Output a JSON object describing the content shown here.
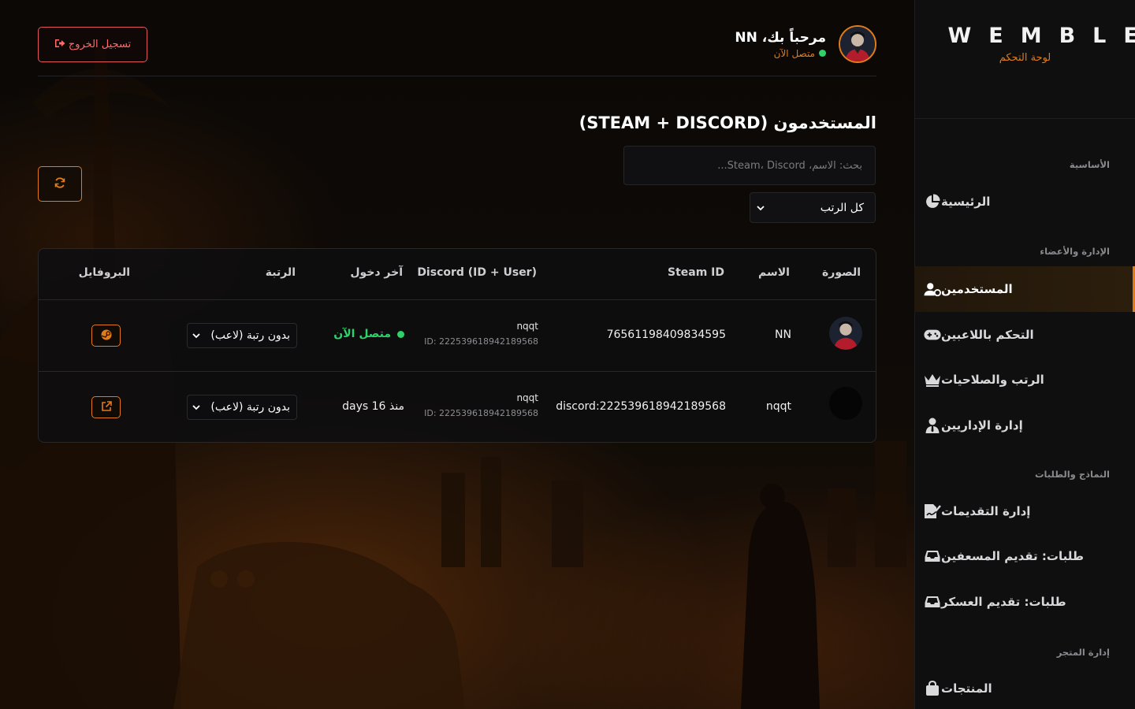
{
  "brand": {
    "name": "WEMBLEY",
    "subtitle": "لوحة التحكم"
  },
  "sidebar": {
    "sections": [
      {
        "title": "الأساسية"
      },
      {
        "title": "الإدارة والأعضاء"
      },
      {
        "title": "النماذج والطلبات"
      },
      {
        "title": "إدارة المتجر"
      }
    ],
    "items": [
      {
        "label": "الرئيسية",
        "icon": "pie-chart-icon"
      },
      {
        "label": "المستخدمين",
        "icon": "user-gear-icon",
        "active": true
      },
      {
        "label": "التحكم باللاعبين",
        "icon": "gamepad-icon"
      },
      {
        "label": "الرتب والصلاحيات",
        "icon": "crown-icon"
      },
      {
        "label": "إدارة الإداريين",
        "icon": "user-tie-icon"
      },
      {
        "label": "إدارة التقديمات",
        "icon": "file-signature-icon"
      },
      {
        "label": "طلبات: تقديم المسعفين",
        "icon": "inbox-icon"
      },
      {
        "label": "طلبات: تقديم العسكر",
        "icon": "inbox-icon"
      },
      {
        "label": "المنتجات",
        "icon": "bag-icon"
      }
    ]
  },
  "header": {
    "welcome": "مرحباً بك، NN",
    "status": "متصل الآن",
    "logout_label": "تسجيل الخروج"
  },
  "main": {
    "title": "المستخدمون (STEAM + DISCORD)",
    "search_placeholder": "بحث: الاسم، Steam، Discord...",
    "rank_filter": "كل الرتب"
  },
  "table": {
    "columns": [
      "الصورة",
      "الاسم",
      "Steam ID",
      "Discord (ID + User)",
      "آخر دخول",
      "الرتبة",
      "البروفايل"
    ],
    "rows": [
      {
        "name": "NN",
        "steam_id": "76561198409834595",
        "discord_user": "nqqt",
        "discord_id": "ID: 222539618942189568",
        "last_login": "متصل الآن",
        "online": true,
        "rank": "بدون رتبة (لاعب)",
        "profile_icon": "steam-icon"
      },
      {
        "name": "nqqt",
        "steam_id": "discord:222539618942189568",
        "discord_user": "nqqt",
        "discord_id": "ID: 222539618942189568",
        "last_login": "منذ 16 days",
        "online": false,
        "rank": "بدون رتبة (لاعب)",
        "profile_icon": "external-link-icon"
      }
    ]
  },
  "colors": {
    "accent": "#e07b1a",
    "online": "#2fd16a",
    "danger": "#ff6b6b"
  }
}
